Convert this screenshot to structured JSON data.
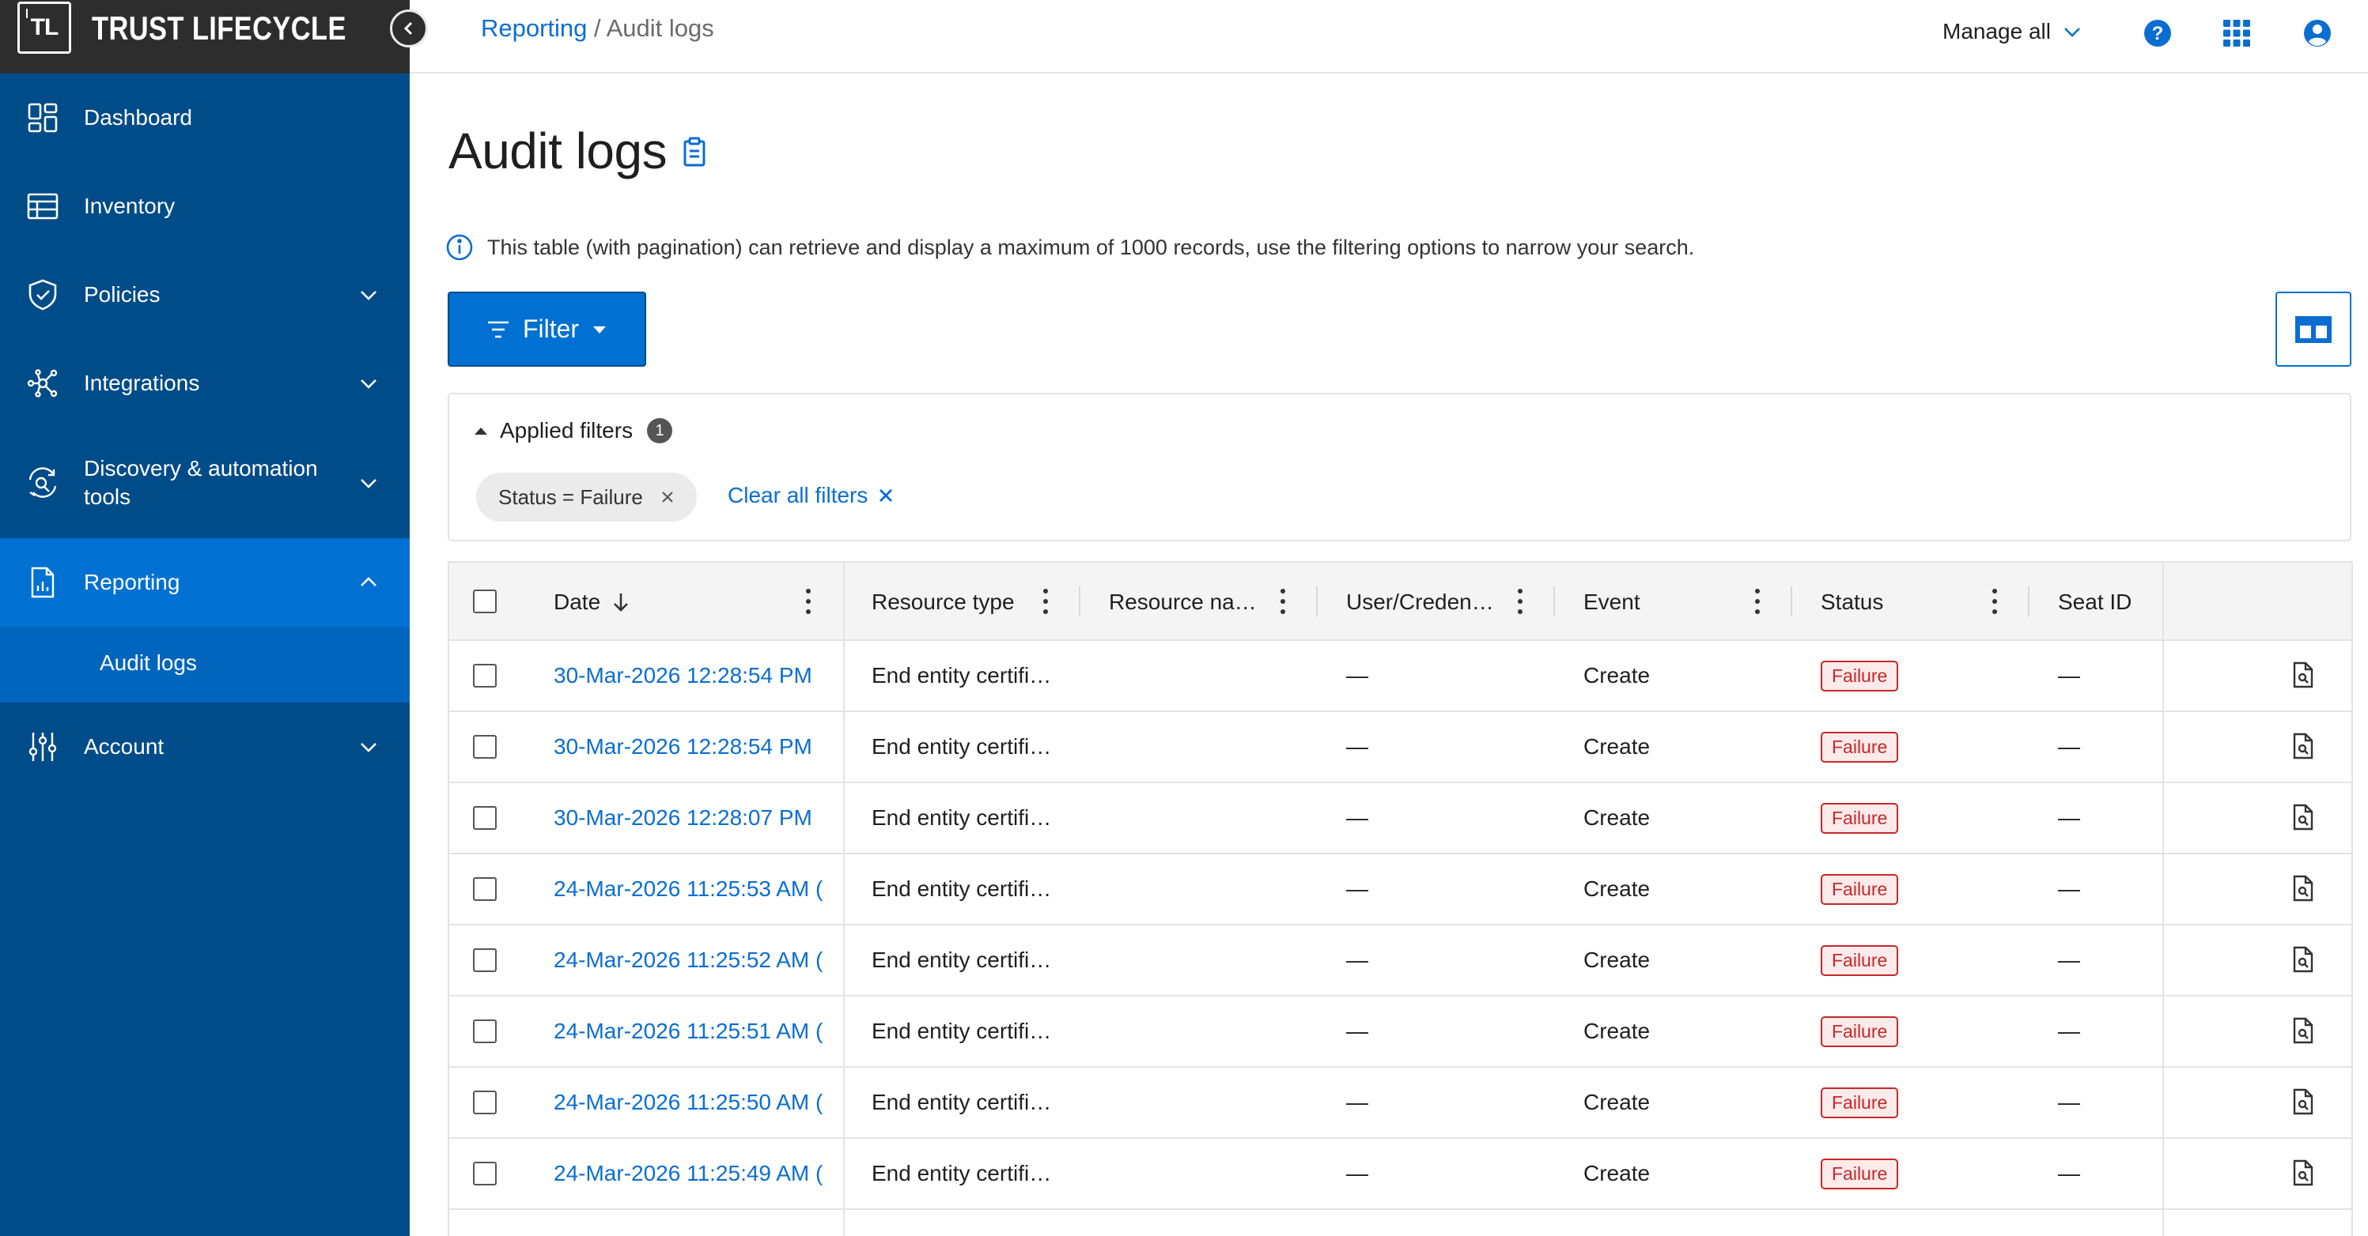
{
  "brand": {
    "logo_text": "TL",
    "name": "TRUST LIFECYCLE"
  },
  "sidebar": {
    "items": [
      {
        "label": "Dashboard",
        "icon": "dashboard-icon"
      },
      {
        "label": "Inventory",
        "icon": "table-icon"
      },
      {
        "label": "Policies",
        "icon": "shield-icon",
        "expandable": true
      },
      {
        "label": "Integrations",
        "icon": "network-icon",
        "expandable": true
      },
      {
        "label": "Discovery & automation tools",
        "icon": "discovery-icon",
        "expandable": true
      },
      {
        "label": "Reporting",
        "icon": "report-icon",
        "expandable": true,
        "expanded": true,
        "active": true
      },
      {
        "label": "Account",
        "icon": "sliders-icon",
        "expandable": true
      }
    ],
    "subitems": [
      {
        "label": "Audit logs",
        "selected": true
      }
    ]
  },
  "header": {
    "breadcrumb_parent": "Reporting",
    "breadcrumb_separator": " / ",
    "breadcrumb_current": "Audit logs",
    "manage_label": "Manage all",
    "icons": [
      "help-icon",
      "apps-grid-icon",
      "user-account-icon"
    ]
  },
  "page": {
    "title": "Audit logs",
    "info_text": "This table (with pagination) can retrieve and display a maximum of 1000 records, use the filtering options to narrow your search.",
    "filter_button": "Filter",
    "applied_filters_label": "Applied filters",
    "applied_filters_count": "1",
    "filter_chip": "Status = Failure",
    "clear_all_label": "Clear all filters"
  },
  "table": {
    "columns": [
      "Date",
      "Resource type",
      "Resource na…",
      "User/Creden…",
      "Event",
      "Status",
      "Seat ID"
    ],
    "sort_column": "Date",
    "sort_direction": "descending",
    "rows": [
      {
        "date": "30-Mar-2026 12:28:54 PM",
        "resource_type": "End entity certifi…",
        "resource_name": "",
        "user": "—",
        "event": "Create",
        "status": "Failure",
        "seat_id": "—"
      },
      {
        "date": "30-Mar-2026 12:28:54 PM",
        "resource_type": "End entity certifi…",
        "resource_name": "",
        "user": "—",
        "event": "Create",
        "status": "Failure",
        "seat_id": "—"
      },
      {
        "date": "30-Mar-2026 12:28:07 PM",
        "resource_type": "End entity certifi…",
        "resource_name": "",
        "user": "—",
        "event": "Create",
        "status": "Failure",
        "seat_id": "—"
      },
      {
        "date": "24-Mar-2026 11:25:53 AM (",
        "resource_type": "End entity certifi…",
        "resource_name": "",
        "user": "—",
        "event": "Create",
        "status": "Failure",
        "seat_id": "—"
      },
      {
        "date": "24-Mar-2026 11:25:52 AM (",
        "resource_type": "End entity certifi…",
        "resource_name": "",
        "user": "—",
        "event": "Create",
        "status": "Failure",
        "seat_id": "—"
      },
      {
        "date": "24-Mar-2026 11:25:51 AM (",
        "resource_type": "End entity certifi…",
        "resource_name": "",
        "user": "—",
        "event": "Create",
        "status": "Failure",
        "seat_id": "—"
      },
      {
        "date": "24-Mar-2026 11:25:50 AM (",
        "resource_type": "End entity certifi…",
        "resource_name": "",
        "user": "—",
        "event": "Create",
        "status": "Failure",
        "seat_id": "—"
      },
      {
        "date": "24-Mar-2026 11:25:49 AM (",
        "resource_type": "End entity certifi…",
        "resource_name": "",
        "user": "—",
        "event": "Create",
        "status": "Failure",
        "seat_id": "—"
      }
    ]
  },
  "colors": {
    "sidebar_bg": "#004c89",
    "sidebar_active": "#0071d2",
    "brand_bar": "#2d2d2d",
    "link": "#0a6ed1",
    "failure": "#c62828"
  }
}
